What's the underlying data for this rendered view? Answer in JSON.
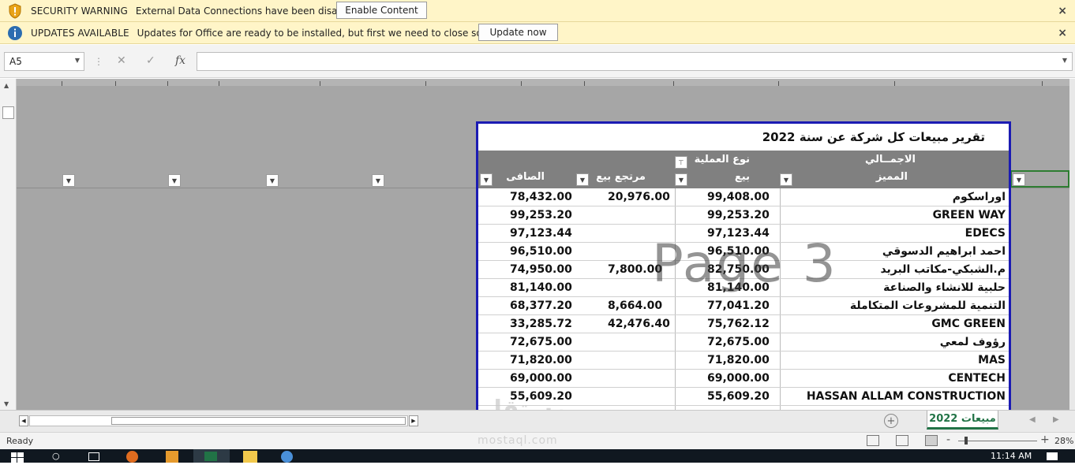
{
  "security_bar": {
    "title": "SECURITY WARNING",
    "message": "External Data Connections have been disabled",
    "button": "Enable Content",
    "close": "×"
  },
  "updates_bar": {
    "title": "UPDATES AVAILABLE",
    "message": "Updates for Office are ready to be installed, but first we need to close some apps.",
    "button": "Update now",
    "close": "×"
  },
  "formula_bar": {
    "name_box": "A5",
    "cancel_glyph": "✕",
    "enter_glyph": "✓",
    "fx_label": "fx",
    "value": ""
  },
  "report": {
    "title": "تقرير مبيعات كل شركة عن سنة 2022",
    "header": {
      "total_group": "الاجمــالي",
      "name_col": "المميز",
      "op_type_group": "نوع العملية",
      "sale_col": "بيع",
      "return_col": "مرتجع بيع",
      "net_col": "الصافى"
    },
    "rows": [
      {
        "name": "اوراسكوم",
        "sale": "99,408.00",
        "return": "20,976.00",
        "net": "78,432.00"
      },
      {
        "name": "GREEN WAY",
        "sale": "99,253.20",
        "return": "",
        "net": "99,253.20"
      },
      {
        "name": "EDECS",
        "sale": "97,123.44",
        "return": "",
        "net": "97,123.44"
      },
      {
        "name": "احمد ابراهيم الدسوقي",
        "sale": "96,510.00",
        "return": "",
        "net": "96,510.00"
      },
      {
        "name": "م.الشبكي-مكاتب البريد",
        "sale": "82,750.00",
        "return": "7,800.00",
        "net": "74,950.00"
      },
      {
        "name": "حلبية للانشاء والصناعة",
        "sale": "81,140.00",
        "return": "",
        "net": "81,140.00"
      },
      {
        "name": "التنمية للمشروعات المتكاملة",
        "sale": "77,041.20",
        "return": "8,664.00",
        "net": "68,377.20"
      },
      {
        "name": "GMC GREEN",
        "sale": "75,762.12",
        "return": "42,476.40",
        "net": "33,285.72"
      },
      {
        "name": "رؤوف لمعي",
        "sale": "72,675.00",
        "return": "",
        "net": "72,675.00"
      },
      {
        "name": "MAS",
        "sale": "71,820.00",
        "return": "",
        "net": "71,820.00"
      },
      {
        "name": "CENTECH",
        "sale": "69,000.00",
        "return": "",
        "net": "69,000.00"
      },
      {
        "name": "HASSAN ALLAM CONSTRUCTION",
        "sale": "55,609.20",
        "return": "",
        "net": "55,609.20"
      }
    ]
  },
  "page_watermark": "Page 3",
  "brand_watermark": "مستقل",
  "brand_watermark_sub": "mostaql.com",
  "sheet_tab": "مبيعات 2022",
  "status": {
    "ready": "Ready",
    "zoom": "28%",
    "zoom_minus": "-",
    "zoom_plus": "+"
  },
  "taskbar": {
    "time": "11:14 AM"
  },
  "colors": {
    "message_bar": "#fff5c8",
    "page_border": "#1b1bb3",
    "header_fill": "#808080",
    "sheet_tab_accent": "#217346"
  }
}
